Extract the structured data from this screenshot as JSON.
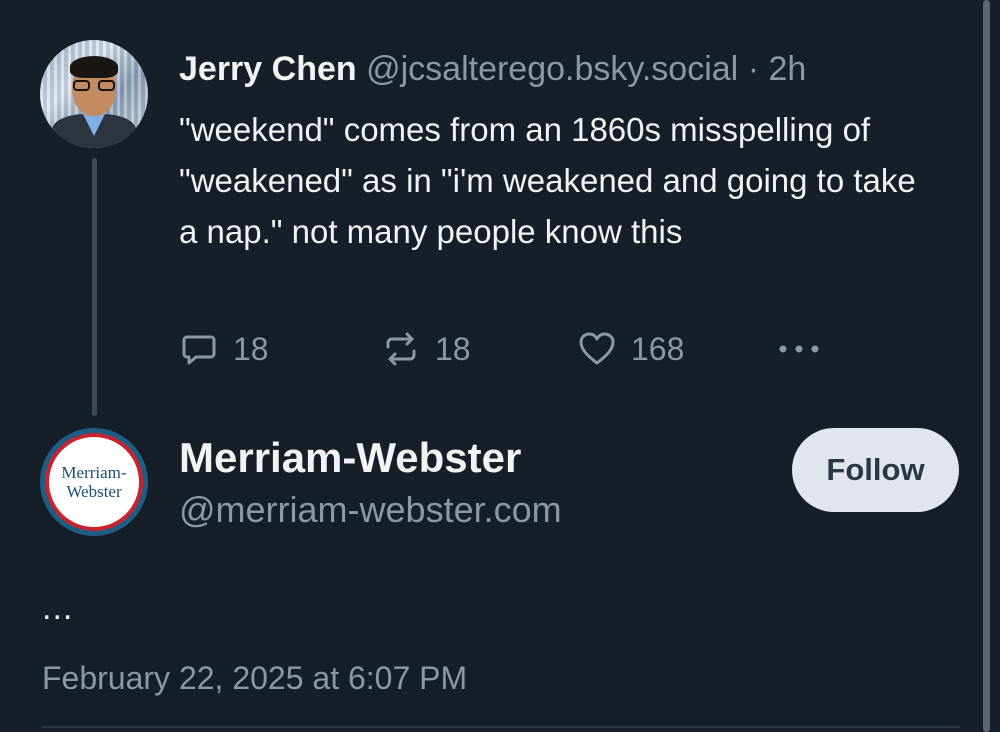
{
  "parent_post": {
    "author_name": "Jerry Chen",
    "author_handle": "@jcsalterego.bsky.social",
    "separator": "·",
    "time": "2h",
    "text": "\"weekend\" comes from an 1860s misspelling of \"weakened\" as in \"i'm weakened and going to take a nap.\" not many people know this",
    "actions": {
      "reply_count": "18",
      "repost_count": "18",
      "like_count": "168"
    }
  },
  "main_post": {
    "author_name": "Merriam-Webster",
    "author_handle": "@merriam-webster.com",
    "avatar_logo_line1": "Merriam-",
    "avatar_logo_line2": "Webster",
    "follow_label": "Follow",
    "text": "...",
    "date": "February 22, 2025 at 6:07 PM"
  },
  "colors": {
    "background": "#161e27",
    "primary_text": "#f1f3f5",
    "secondary_text": "#8d98a5",
    "thread_line": "#3e4956",
    "follow_button_bg": "#e0e6eb",
    "follow_button_text": "#2a3744",
    "brand_blue": "#1b4f74",
    "brand_red": "#c8242f"
  },
  "icons": {
    "reply": "speech-bubble-icon",
    "repost": "repost-arrows-icon",
    "like": "heart-icon",
    "more": "more-dots-icon"
  }
}
